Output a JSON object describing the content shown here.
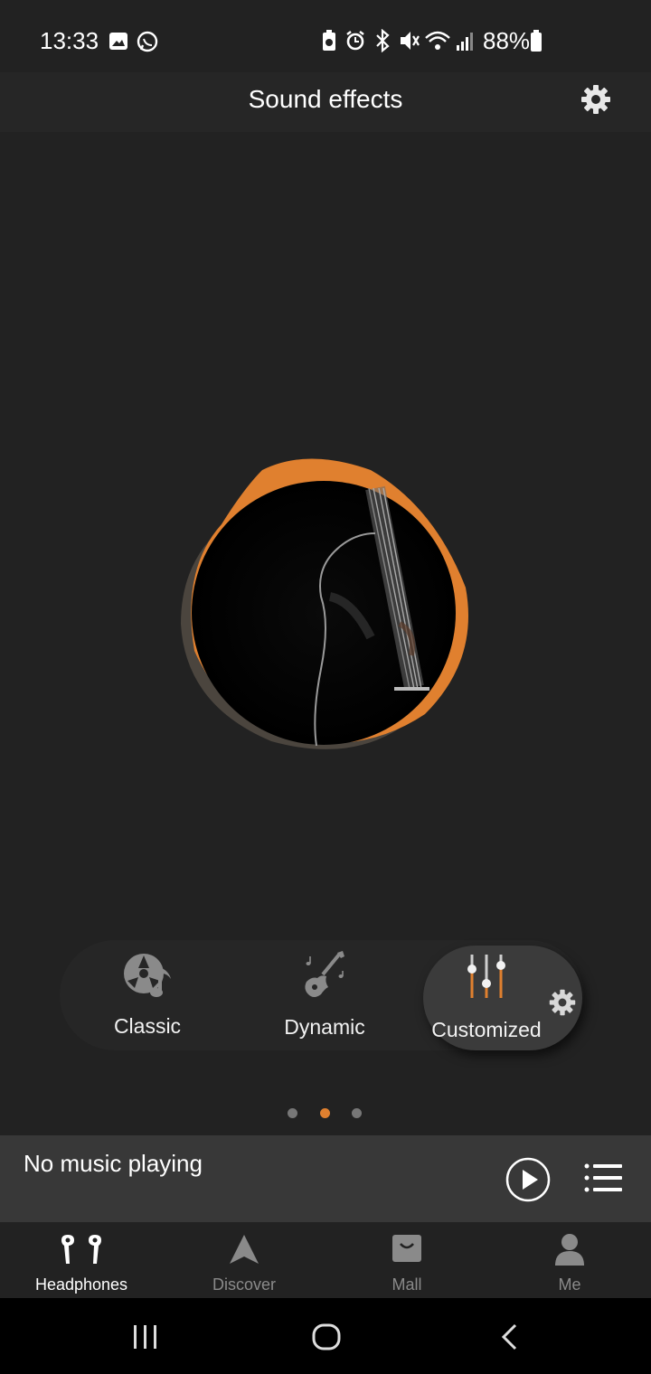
{
  "status_bar": {
    "time": "13:33",
    "battery_percent": "88%",
    "icons": [
      "gallery-icon",
      "whatsapp-icon",
      "battery-saver-icon",
      "alarm-icon",
      "bluetooth-icon",
      "mute-icon",
      "wifi-icon",
      "signal-icon",
      "battery-icon"
    ]
  },
  "header": {
    "title": "Sound effects",
    "settings_icon": "gear-icon"
  },
  "effects": {
    "items": [
      {
        "label": "Classic",
        "icon": "vinyl-music-icon"
      },
      {
        "label": "Dynamic",
        "icon": "electric-guitar-icon"
      },
      {
        "label": "Customized",
        "icon": "equalizer-sliders-icon",
        "selected": true
      }
    ],
    "page_index": 2,
    "page_count": 3
  },
  "player": {
    "status": "No music playing"
  },
  "nav": {
    "items": [
      {
        "label": "Headphones",
        "active": true
      },
      {
        "label": "Discover",
        "active": false
      },
      {
        "label": "Mall",
        "active": false
      },
      {
        "label": "Me",
        "active": false
      }
    ]
  },
  "colors": {
    "accent": "#E0802F",
    "background": "#222222",
    "player_bar": "#383838",
    "inactive": "#8a8a8a"
  }
}
